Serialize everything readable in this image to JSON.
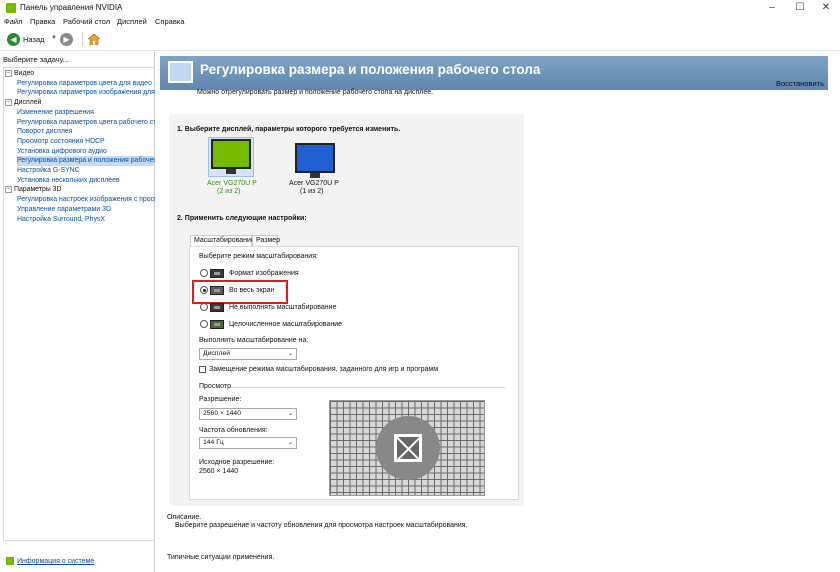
{
  "window": {
    "title": "Панель управления NVIDIA",
    "minimize": "–",
    "maximize": "☐",
    "close": "✕"
  },
  "menu": [
    "Файл",
    "Правка",
    "Рабочий стол",
    "Дисплей",
    "Справка"
  ],
  "toolbar": {
    "back": "Назад",
    "back_icon": "arrow-left",
    "forward_icon": "arrow-right",
    "home_icon": "home"
  },
  "sidebar": {
    "title": "Выберите задачу...",
    "tree": [
      {
        "label": "Видео",
        "type": "category"
      },
      {
        "label": "Регулировка параметров цвета для видео",
        "type": "item"
      },
      {
        "label": "Регулировка параметров изображения для видео",
        "type": "item"
      },
      {
        "label": "Дисплей",
        "type": "category"
      },
      {
        "label": "Изменение разрешения",
        "type": "item"
      },
      {
        "label": "Регулировка параметров цвета рабочего стола",
        "type": "item"
      },
      {
        "label": "Поворот дисплея",
        "type": "item"
      },
      {
        "label": "Просмотр состояния HDCP",
        "type": "item"
      },
      {
        "label": "Установка цифрового аудио",
        "type": "item"
      },
      {
        "label": "Регулировка размера и положения рабочего стола",
        "type": "item",
        "selected": true
      },
      {
        "label": "Настройка G-SYNC",
        "type": "item"
      },
      {
        "label": "Установка нескольких дисплеев",
        "type": "item"
      },
      {
        "label": "Параметры 3D",
        "type": "category"
      },
      {
        "label": "Регулировка настроек изображения с просмотром",
        "type": "item"
      },
      {
        "label": "Управление параметрами 3D",
        "type": "item"
      },
      {
        "label": "Настройка Surround, PhysX",
        "type": "item"
      }
    ],
    "system_info": "Информация о системе"
  },
  "main": {
    "title": "Регулировка размера и положения рабочего стола",
    "restore": "Восстановить",
    "intro": "Можно отрегулировать размер и положение рабочего стола на дисплее.",
    "step1": "1. Выберите дисплей, параметры которого требуется изменить.",
    "displays": [
      {
        "name": "Acer VG270U P",
        "index": "(2 из 2)",
        "selected": true,
        "screen_color": "#76b900"
      },
      {
        "name": "Acer VG270U P",
        "index": "(1 из 2)",
        "selected": false,
        "screen_color": "#1f5fd1"
      }
    ],
    "step2": "2. Применить следующие настройки:",
    "tabs": [
      "Масштабирование",
      "Размер"
    ],
    "scaling": {
      "mode_label": "Выберите режим масштабирования:",
      "modes": [
        {
          "label": "Формат изображения",
          "selected": false
        },
        {
          "label": "Во весь экран",
          "selected": true
        },
        {
          "label": "Не выполнять масштабирование",
          "selected": false
        },
        {
          "label": "Целочисленное масштабирование",
          "selected": false
        }
      ],
      "perform_on_label": "Выполнить масштабирование на:",
      "perform_on_value": "Дисплей",
      "override_label": "Замещение режима масштабирования, заданного для игр и программ",
      "override_checked": false,
      "preview_label": "Просмотр",
      "resolution_label": "Разрешение:",
      "resolution_value": "2560 × 1440",
      "refresh_label": "Частота обновления:",
      "refresh_value": "144 Гц",
      "native_label": "Исходное разрешение:",
      "native_value": "2560 × 1440"
    },
    "description_label": "Описание.",
    "description_text": "Выберите разрешение и частоту обновления для просмотра настроек масштабирования.",
    "typical_label": "Типичные ситуации применения."
  },
  "colors": {
    "accent": "#76b900",
    "header": "#6f97bf",
    "highlight_box": "#d62020",
    "link": "#0a4fa0"
  }
}
